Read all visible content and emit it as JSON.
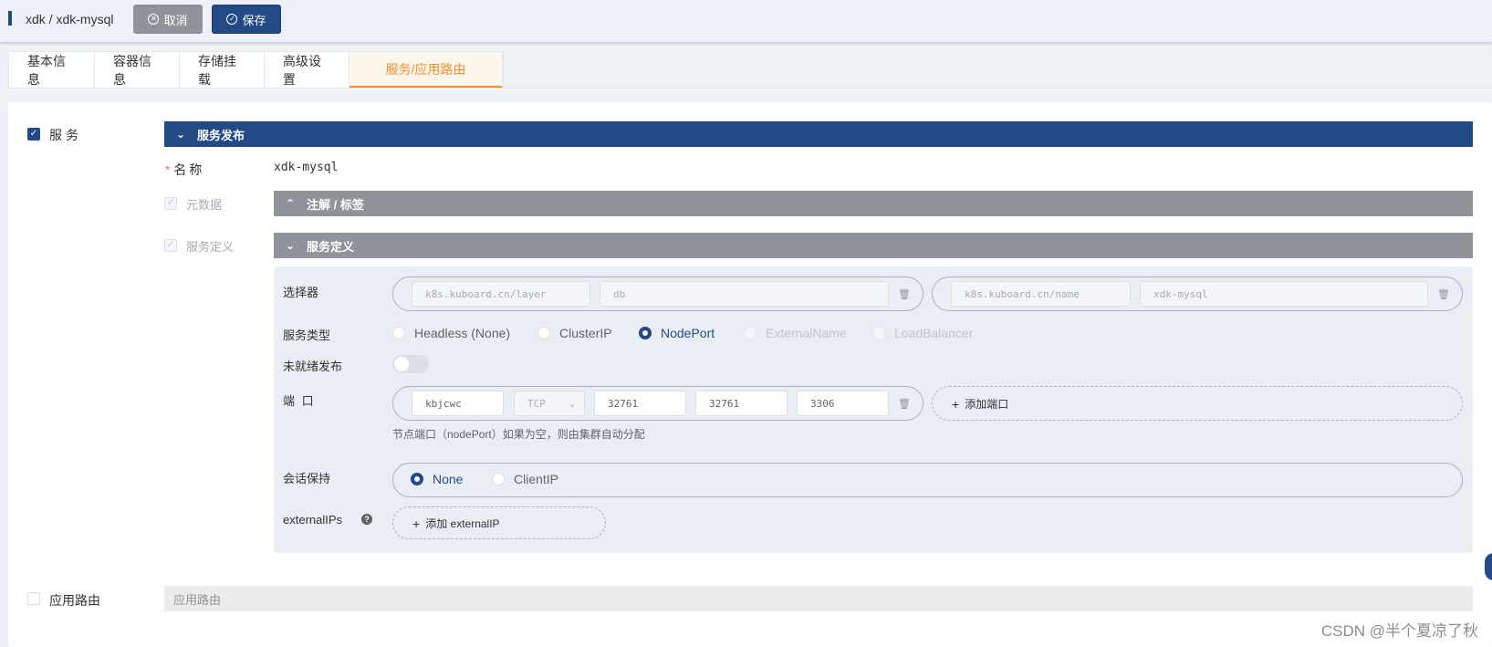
{
  "header": {
    "title": "xdk / xdk-mysql",
    "cancel_label": "取消",
    "save_label": "保存"
  },
  "tabs": [
    {
      "label": "基本信息"
    },
    {
      "label": "容器信息"
    },
    {
      "label": "存储挂载"
    },
    {
      "label": "高级设置"
    },
    {
      "label": "服务/应用路由",
      "active": true
    }
  ],
  "service": {
    "checkbox_label": "服务",
    "checked": true,
    "section_title": "服务发布",
    "name_label": "名称",
    "name_value": "xdk-mysql",
    "metadata_label": "元数据",
    "annotations_title": "注解 / 标签",
    "definition_label": "服务定义",
    "definition_title": "服务定义",
    "selector": {
      "label": "选择器",
      "pairs": [
        {
          "key": "k8s.kuboard.cn/layer",
          "value": "db"
        },
        {
          "key": "k8s.kuboard.cn/name",
          "value": "xdk-mysql"
        }
      ]
    },
    "service_type": {
      "label": "服务类型",
      "options": [
        "Headless (None)",
        "ClusterIP",
        "NodePort",
        "ExternalName",
        "LoadBalancer"
      ],
      "selected": "NodePort"
    },
    "unready_publish": {
      "label": "未就绪发布",
      "enabled": false
    },
    "ports": {
      "label": "端 口",
      "name": "kbjcwc",
      "protocol": "TCP",
      "node_port": "32761",
      "port": "32761",
      "target_port": "3306",
      "add_label": "添加端口",
      "hint": "节点端口（nodePort）如果为空，则由集群自动分配"
    },
    "session_affinity": {
      "label": "会话保持",
      "options": [
        "None",
        "ClientIP"
      ],
      "selected": "None"
    },
    "external_ips": {
      "label": "externalIPs",
      "add_label": "添加 externalIP"
    }
  },
  "route": {
    "checkbox_label": "应用路由",
    "checked": false,
    "bar_label": "应用路由"
  },
  "watermark": "CSDN @半个夏凉了秋",
  "colors": {
    "primary": "#244a86",
    "tab_active": "#f08f2d",
    "gray_bar": "#909399"
  }
}
